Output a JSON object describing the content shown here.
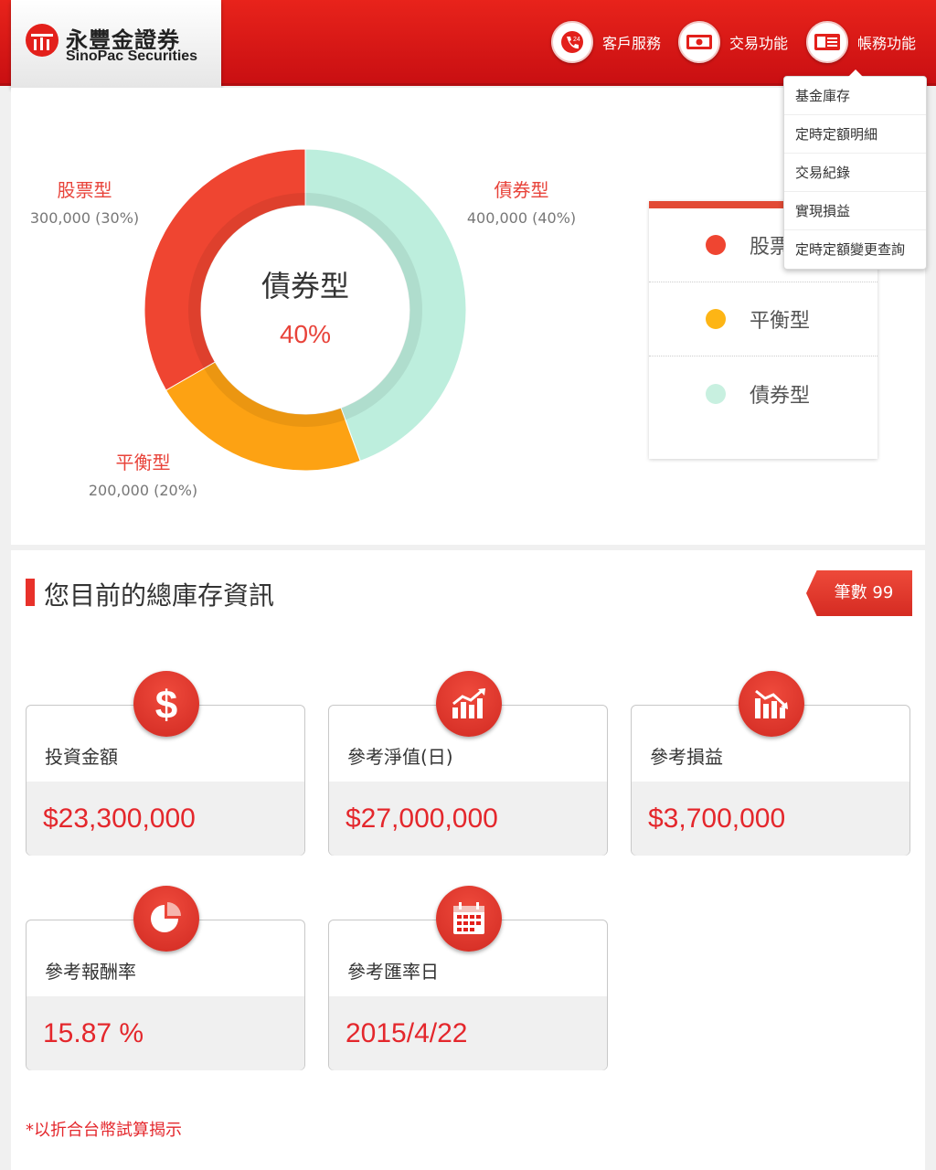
{
  "header": {
    "logo_cn": "永豐金證券",
    "logo_en": "SinoPac Securities",
    "nav": [
      {
        "label": "客戶服務",
        "icon": "phone-24-icon"
      },
      {
        "label": "交易功能",
        "icon": "cash-icon"
      },
      {
        "label": "帳務功能",
        "icon": "id-card-icon"
      }
    ]
  },
  "dropdown": {
    "items": [
      "基金庫存",
      "定時定額明細",
      "交易紀錄",
      "實現損益",
      "定時定額變更查詢"
    ]
  },
  "chart_data": {
    "type": "pie",
    "categories": [
      "股票型",
      "平衡型",
      "債券型"
    ],
    "values": [
      300000,
      200000,
      400000
    ],
    "value_labels": [
      "300,000 (30%)",
      "200,000 (20%)",
      "400,000 (40%)"
    ],
    "colors": [
      "#ef4531",
      "#fda213",
      "#bdeedd"
    ],
    "center_title": "債券型",
    "center_value": "40%"
  },
  "legend": {
    "items": [
      {
        "label": "股票",
        "color": "#ef4531"
      },
      {
        "label": "平衡型",
        "color": "#fdb515"
      },
      {
        "label": "債券型",
        "color": "#c8f0e0"
      }
    ]
  },
  "summary": {
    "title": "您目前的總庫存資訊",
    "count_label": "筆數 99",
    "cards": [
      {
        "label": "投資金額",
        "value": "$23,300,000",
        "icon": "dollar-icon"
      },
      {
        "label": "參考淨值(日)",
        "value": "$27,000,000",
        "icon": "chart-up-icon"
      },
      {
        "label": "參考損益",
        "value": "$3,700,000",
        "icon": "chart-down-icon"
      },
      {
        "label": "參考報酬率",
        "value": "15.87 %",
        "icon": "pie-icon"
      },
      {
        "label": "參考匯率日",
        "value": "2015/4/22",
        "icon": "calendar-icon"
      }
    ],
    "footnote": "*以折合台幣試算揭示"
  }
}
